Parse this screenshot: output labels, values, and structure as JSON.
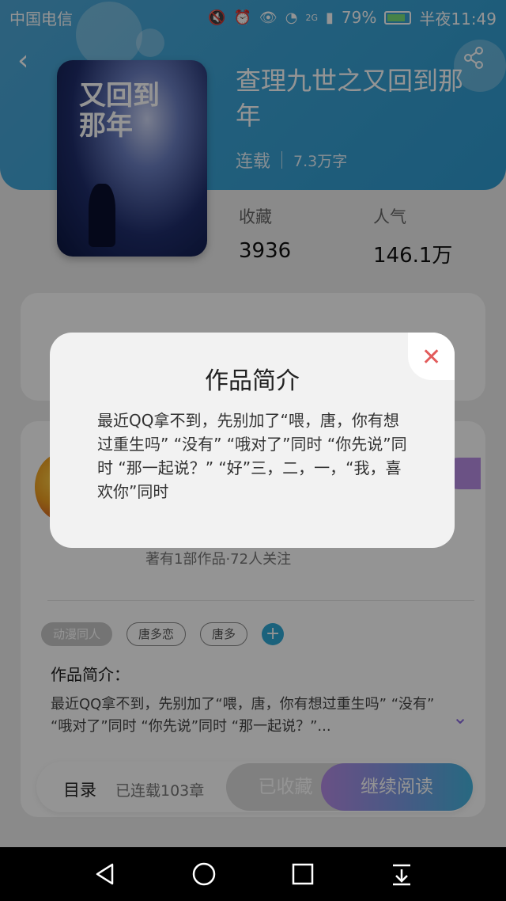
{
  "status_bar": {
    "carrier": "中国电信",
    "battery": "79%",
    "time": "半夜11:49",
    "network": "2G"
  },
  "book": {
    "title": "查理九世之又回到那年",
    "status": "连载",
    "word_count": "7.3万字",
    "cover_title": "又回到那年"
  },
  "stats": {
    "favorites_label": "收藏",
    "favorites_value": "3936",
    "popularity_label": "人气",
    "popularity_value": "146.1万"
  },
  "author": {
    "info": "著有1部作品·72人关注"
  },
  "tags": [
    "动漫同人",
    "唐多恋",
    "唐多"
  ],
  "intro": {
    "label": "作品简介：",
    "text": "最近QQ拿不到，先别加了“喂，唐，你有想过重生吗” “没有” “哦对了”同时 “你先说”同时 “那一起说？”..."
  },
  "bottom_bar": {
    "toc_label": "目录",
    "chapters": "已连载103章",
    "collected_label": "已收藏",
    "read_label": "继续阅读"
  },
  "modal": {
    "title": "作品简介",
    "body": "最近QQ拿不到，先别加了“喂，唐，你有想过重生吗” “没有” “哦对了”同时 “你先说”同时 “那一起说？” “好”三，二，一，“我，喜欢你”同时"
  },
  "colors": {
    "hero": "#3aa3d6",
    "accent_purple": "#b58be6",
    "close_red": "#e25b5b"
  }
}
